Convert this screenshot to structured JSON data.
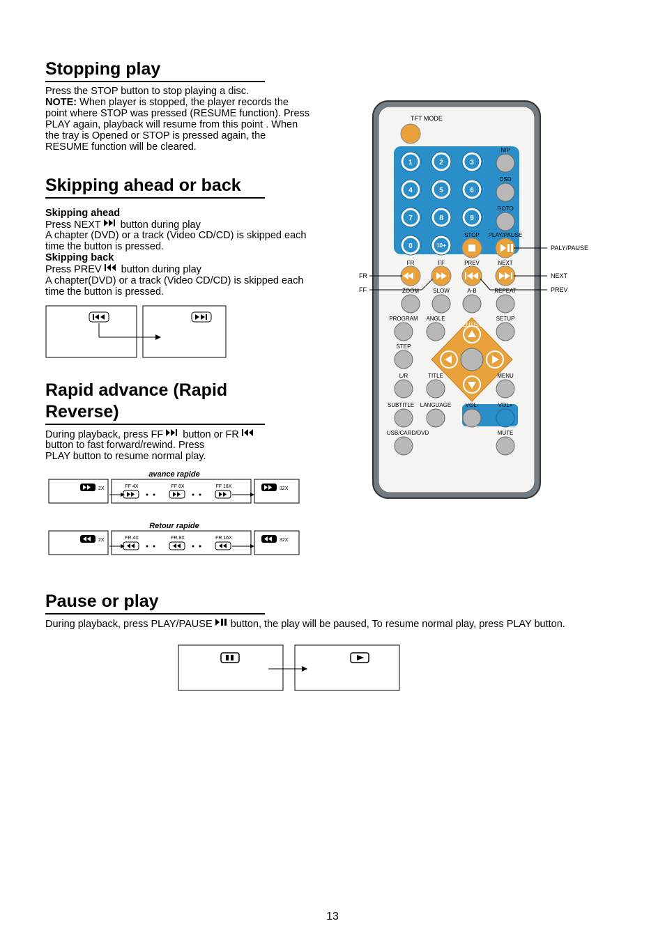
{
  "page_number": "13",
  "sections": {
    "stopping": {
      "title": "Stopping play",
      "p1": "Press the STOP button to stop playing a disc.",
      "note_label": "NOTE:",
      "note_body": " When player is stopped, the player records the point where STOP was pressed (RESUME function). Press PLAY again, playback will resume from this point . When the tray is Opened or STOP is pressed again, the RESUME function will be cleared."
    },
    "skipping": {
      "title": "Skipping ahead or back",
      "ahead_title": "Skipping ahead",
      "ahead_l1a": "Press NEXT ",
      "ahead_l1b": " button during play",
      "ahead_l2": "A chapter (DVD) or a track (Video CD/CD) is skipped each time the button is pressed.",
      "back_title": "Skipping back",
      "back_l1a": "Press PREV ",
      "back_l1b": " button during play",
      "back_l2": "A chapter(DVD) or a track (Video CD/CD) is skipped each time the button is pressed."
    },
    "rapid": {
      "title_l1": "Rapid advance (Rapid",
      "title_l2": "Reverse)",
      "p1a": "During playback, press FF ",
      "p1b": " button or FR ",
      "p1c": "",
      "p2": "button to fast forward/rewind. Press",
      "p3": "PLAY button to resume normal play.",
      "diag": {
        "title_adv": "avance rapide",
        "title_ret": "Retour rapide",
        "ff4": "FF 4X",
        "ff8": "FF 8X",
        "ff16": "FF 16X",
        "fr4": "FR 4X",
        "fr8": "FR 8X",
        "fr16": "FR 16X",
        "x2": "2X",
        "x32": "32X"
      }
    },
    "pause": {
      "title": "Pause or play",
      "p1a": "During playback, press PLAY/PAUSE ",
      "p1b": " button, the play will be paused, To resume normal play, press PLAY button."
    }
  },
  "remote": {
    "tft": "TFT MODE",
    "np": "N/P",
    "osd": "OSD",
    "goto": "GOTO",
    "stop": "STOP",
    "playpause": "PLAY/PAUSE",
    "fr": "FR",
    "ff": "FF",
    "prev": "PREV",
    "next": "NEXT",
    "zoom": "ZOOM",
    "slow": "SLOW",
    "ab": "A-B",
    "repeat": "REPEAT",
    "program": "PROGRAM",
    "angle": "ANGLE",
    "setup": "SETUP",
    "step": "STEP",
    "enter": "ENTER",
    "lr": "L/R",
    "title": "TITLE",
    "menu": "MENU",
    "subtitle": "SUBTITLE",
    "language": "LANGUAGE",
    "volm": "VOL-",
    "volp": "VOL+",
    "usb": "USB/CARD/DVD",
    "mute": "MUTE",
    "callouts": {
      "playpause": "PALY/PAUSE",
      "next": "NEXT",
      "prev": "PREV",
      "fr": "FR",
      "ff": "FF"
    },
    "num": {
      "n1": "1",
      "n2": "2",
      "n3": "3",
      "n4": "4",
      "n5": "5",
      "n6": "6",
      "n7": "7",
      "n8": "8",
      "n9": "9",
      "n0": "0",
      "n10": "10+"
    }
  }
}
